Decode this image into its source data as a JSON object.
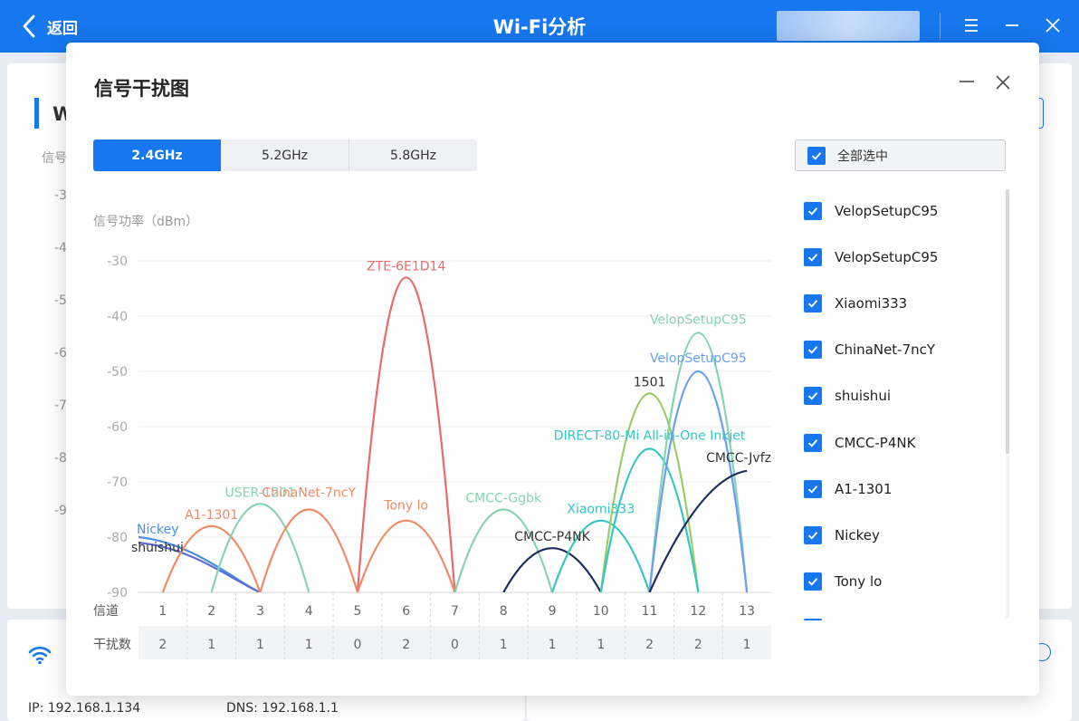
{
  "window": {
    "back_label": "返回",
    "title": "Wi-Fi分析"
  },
  "background": {
    "heading_partial": "W",
    "label_partial": "信号",
    "axis_partial": [
      "-3",
      "-4",
      "-5",
      "-6",
      "-7",
      "-8",
      "-9"
    ],
    "ip_label": "IP: 192.168.1.134",
    "dns_label": "DNS: 192.168.1.1"
  },
  "dialog": {
    "title": "信号干扰图",
    "tabs": [
      {
        "label": "2.4GHz",
        "active": true
      },
      {
        "label": "5.2GHz",
        "active": false
      },
      {
        "label": "5.8GHz",
        "active": false
      }
    ],
    "select_all_label": "全部选中",
    "networks": [
      {
        "label": "VelopSetupC95",
        "checked": true
      },
      {
        "label": "VelopSetupC95",
        "checked": true
      },
      {
        "label": "Xiaomi333",
        "checked": true
      },
      {
        "label": "ChinaNet-7ncY",
        "checked": true
      },
      {
        "label": "shuishui",
        "checked": true
      },
      {
        "label": "CMCC-P4NK",
        "checked": true
      },
      {
        "label": "A1-1301",
        "checked": true
      },
      {
        "label": "Nickey",
        "checked": true
      },
      {
        "label": "Tony lo",
        "checked": true
      }
    ]
  },
  "chart_data": {
    "type": "area",
    "ylabel": "信号功率（dBm）",
    "yticks": [
      -30,
      -40,
      -50,
      -60,
      -70,
      -80,
      -90
    ],
    "ylim": [
      -90,
      -30
    ],
    "xlabel": "信道",
    "categories": [
      "1",
      "2",
      "3",
      "4",
      "5",
      "6",
      "7",
      "8",
      "9",
      "10",
      "11",
      "12",
      "13"
    ],
    "interference_label": "干扰数",
    "interference": [
      2,
      1,
      1,
      1,
      0,
      2,
      0,
      1,
      1,
      1,
      2,
      2,
      1
    ],
    "grid": true,
    "series": [
      {
        "name": "Nickey",
        "color": "#4a90e2",
        "x0": 0.5,
        "xpeak": 0.5,
        "x1": 3,
        "peak": -80
      },
      {
        "name": "shuishui",
        "color": "#5b6fd6",
        "x0": 0.5,
        "xpeak": 0.5,
        "x1": 3,
        "peak": -81
      },
      {
        "name": "A1-1301",
        "color": "#f08a62",
        "x0": 1,
        "xpeak": 2,
        "x1": 3,
        "peak": -78
      },
      {
        "name": "USER-1201",
        "color": "#86d3b3",
        "x0": 2,
        "xpeak": 3,
        "x1": 4,
        "peak": -74
      },
      {
        "name": "ChinaNet-7ncY",
        "color": "#f08a62",
        "x0": 3,
        "xpeak": 4,
        "x1": 5,
        "peak": -75
      },
      {
        "name": "ZTE-6E1D14",
        "color": "#e86a6a",
        "x0": 5,
        "xpeak": 6,
        "x1": 7,
        "peak": -33
      },
      {
        "name": "Tony lo",
        "color": "#f08a62",
        "x0": 5,
        "xpeak": 6,
        "x1": 7,
        "peak": -77
      },
      {
        "name": "CMCC-Ggbk",
        "color": "#86d3b3",
        "x0": 7,
        "xpeak": 8,
        "x1": 9,
        "peak": -75
      },
      {
        "name": "CMCC-P4NK",
        "color": "#1e2d5c",
        "x0": 8,
        "xpeak": 9,
        "x1": 10,
        "peak": -82
      },
      {
        "name": "Xiaomi333",
        "color": "#34c5c5",
        "x0": 9,
        "xpeak": 10,
        "x1": 11,
        "peak": -77
      },
      {
        "name": "1501",
        "color": "#9ccc65",
        "x0": 10,
        "xpeak": 11,
        "x1": 12,
        "peak": -54
      },
      {
        "name": "DIRECT-80-Mi All-in-One Inkjet",
        "color": "#34c5c5",
        "x0": 10,
        "xpeak": 11,
        "x1": 12,
        "peak": -64
      },
      {
        "name": "VelopSetupC95",
        "color": "#86d3b3",
        "x0": 11,
        "xpeak": 12,
        "x1": 13,
        "peak": -43
      },
      {
        "name": "VelopSetupC95",
        "color": "#6a9ef2",
        "x0": 11,
        "xpeak": 12,
        "x1": 13,
        "peak": -50
      },
      {
        "name": "CMCC-Jvfz",
        "color": "#1e2d5c",
        "x0": 11,
        "xpeak": 13,
        "x1": 13,
        "peak": -68
      }
    ]
  }
}
